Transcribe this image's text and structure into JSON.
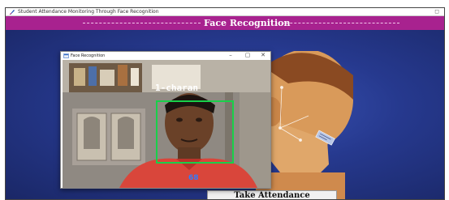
{
  "app": {
    "window_title": "Student Attendance Monitoring Through Face Recognition",
    "header_title": "Face Recognition",
    "take_attendance_label": "Take Attendance"
  },
  "popup": {
    "title": "Face Recognition",
    "controls": {
      "minimize": "–",
      "maximize": "▢",
      "close": "✕"
    },
    "recognized_label": "1-charan",
    "confidence": "68"
  },
  "colors": {
    "header_bg": "#a8228f",
    "body_bg": "#26398e",
    "face_box": "#19d04a",
    "confidence_text": "#2f7cff"
  },
  "icons": [
    "feather-icon",
    "window-icon"
  ]
}
